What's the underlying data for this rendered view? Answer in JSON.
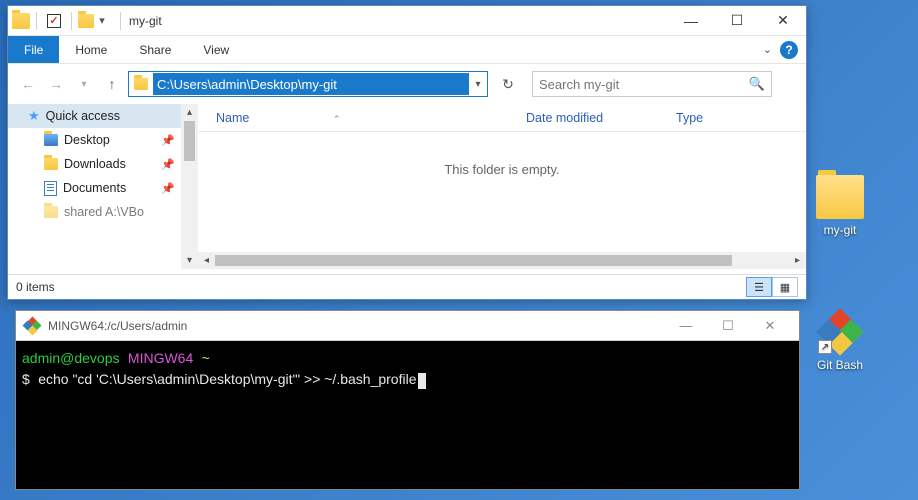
{
  "explorer": {
    "title": "my-git",
    "tabs": {
      "file": "File",
      "home": "Home",
      "share": "Share",
      "view": "View"
    },
    "address": "C:\\Users\\admin\\Desktop\\my-git",
    "search_placeholder": "Search my-git",
    "columns": {
      "name": "Name",
      "date": "Date modified",
      "type": "Type"
    },
    "empty": "This folder is empty.",
    "sidebar": {
      "quick_access": "Quick access",
      "items": [
        {
          "label": "Desktop"
        },
        {
          "label": "Downloads"
        },
        {
          "label": "Documents"
        },
        {
          "label": "shared A:\\VBo"
        }
      ]
    },
    "status": "0 items"
  },
  "terminal": {
    "title": "MINGW64:/c/Users/admin",
    "user": "admin@devops",
    "env": "MINGW64",
    "cwd": "~",
    "prompt": "$",
    "command": "echo \"cd 'C:\\Users\\admin\\Desktop\\my-git'\" >> ~/.bash_profile"
  },
  "desktop": {
    "folder": "my-git",
    "gitbash": "Git Bash"
  }
}
